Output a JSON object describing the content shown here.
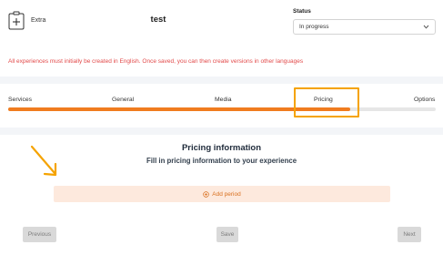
{
  "header": {
    "badge_label": "Extra",
    "title": "test",
    "status_label": "Status",
    "status_value": "In progress"
  },
  "warning": "All experiences must initially be created in English. Once saved, you can then create versions in other languages",
  "steps": {
    "items": [
      {
        "label": "Services"
      },
      {
        "label": "General"
      },
      {
        "label": "Media"
      },
      {
        "label": "Pricing"
      },
      {
        "label": "Options"
      }
    ],
    "active": "Pricing",
    "progress_percent": 80
  },
  "pricing": {
    "title": "Pricing information",
    "subtitle": "Fill in pricing information to your experience",
    "add_period_label": "Add period"
  },
  "footer": {
    "previous_label": "Previous",
    "save_label": "Save",
    "next_label": "Next"
  },
  "colors": {
    "accent": "#f07c1f",
    "highlight": "#f5a300",
    "warning": "#e24a4a",
    "add_bg": "#fde9dd"
  }
}
